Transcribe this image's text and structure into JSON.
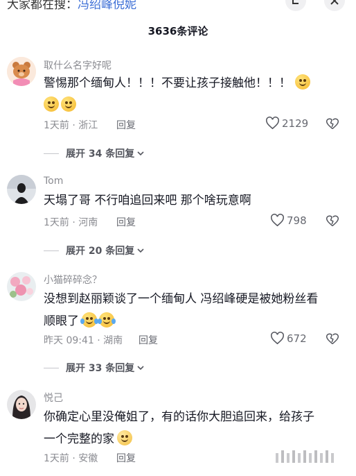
{
  "header": {
    "search_hint_prefix": "大家都在搜：",
    "search_hint_keyword": "冯绍峰倪妮",
    "comment_count_title": "3636条评论"
  },
  "comments": [
    {
      "username": "取什么名字好呢",
      "text": "警惕那个缅甸人！！！不要让孩子接触他！！！",
      "time": "1天前",
      "location": "浙江",
      "reply_label": "回复",
      "likes": "2129",
      "expand_label": "展开 34 条回复"
    },
    {
      "username": "Tom",
      "text": "天塌了哥 不行咱追回来吧 那个啥玩意啊",
      "time": "1天前",
      "location": "河南",
      "reply_label": "回复",
      "likes": "798",
      "expand_label": "展开 20 条回复"
    },
    {
      "username": "小猫碎碎念？",
      "text_line1": "没想到赵丽颖谈了一个缅甸人 冯绍峰硬是被她粉丝看",
      "text_line2": "顺眼了",
      "time": "昨天 09:41",
      "location": "湖南",
      "reply_label": "回复",
      "likes": "672",
      "expand_label": "展开 33 条回复"
    },
    {
      "username": "悦己",
      "text_line1": "你确定心里没俺姐了，有的话你大胆追回来，给孩子",
      "text_line2": "一个完整的家",
      "time": "1天前",
      "location": "安徽",
      "reply_label": "回复"
    }
  ],
  "icons": {
    "like": "heart-outline-icon",
    "dislike": "broken-heart-icon",
    "expand": "chevron-down-icon"
  },
  "colors": {
    "keyword": "#3d6fd6",
    "meta_gray": "#8a8b91",
    "text": "#161823"
  }
}
